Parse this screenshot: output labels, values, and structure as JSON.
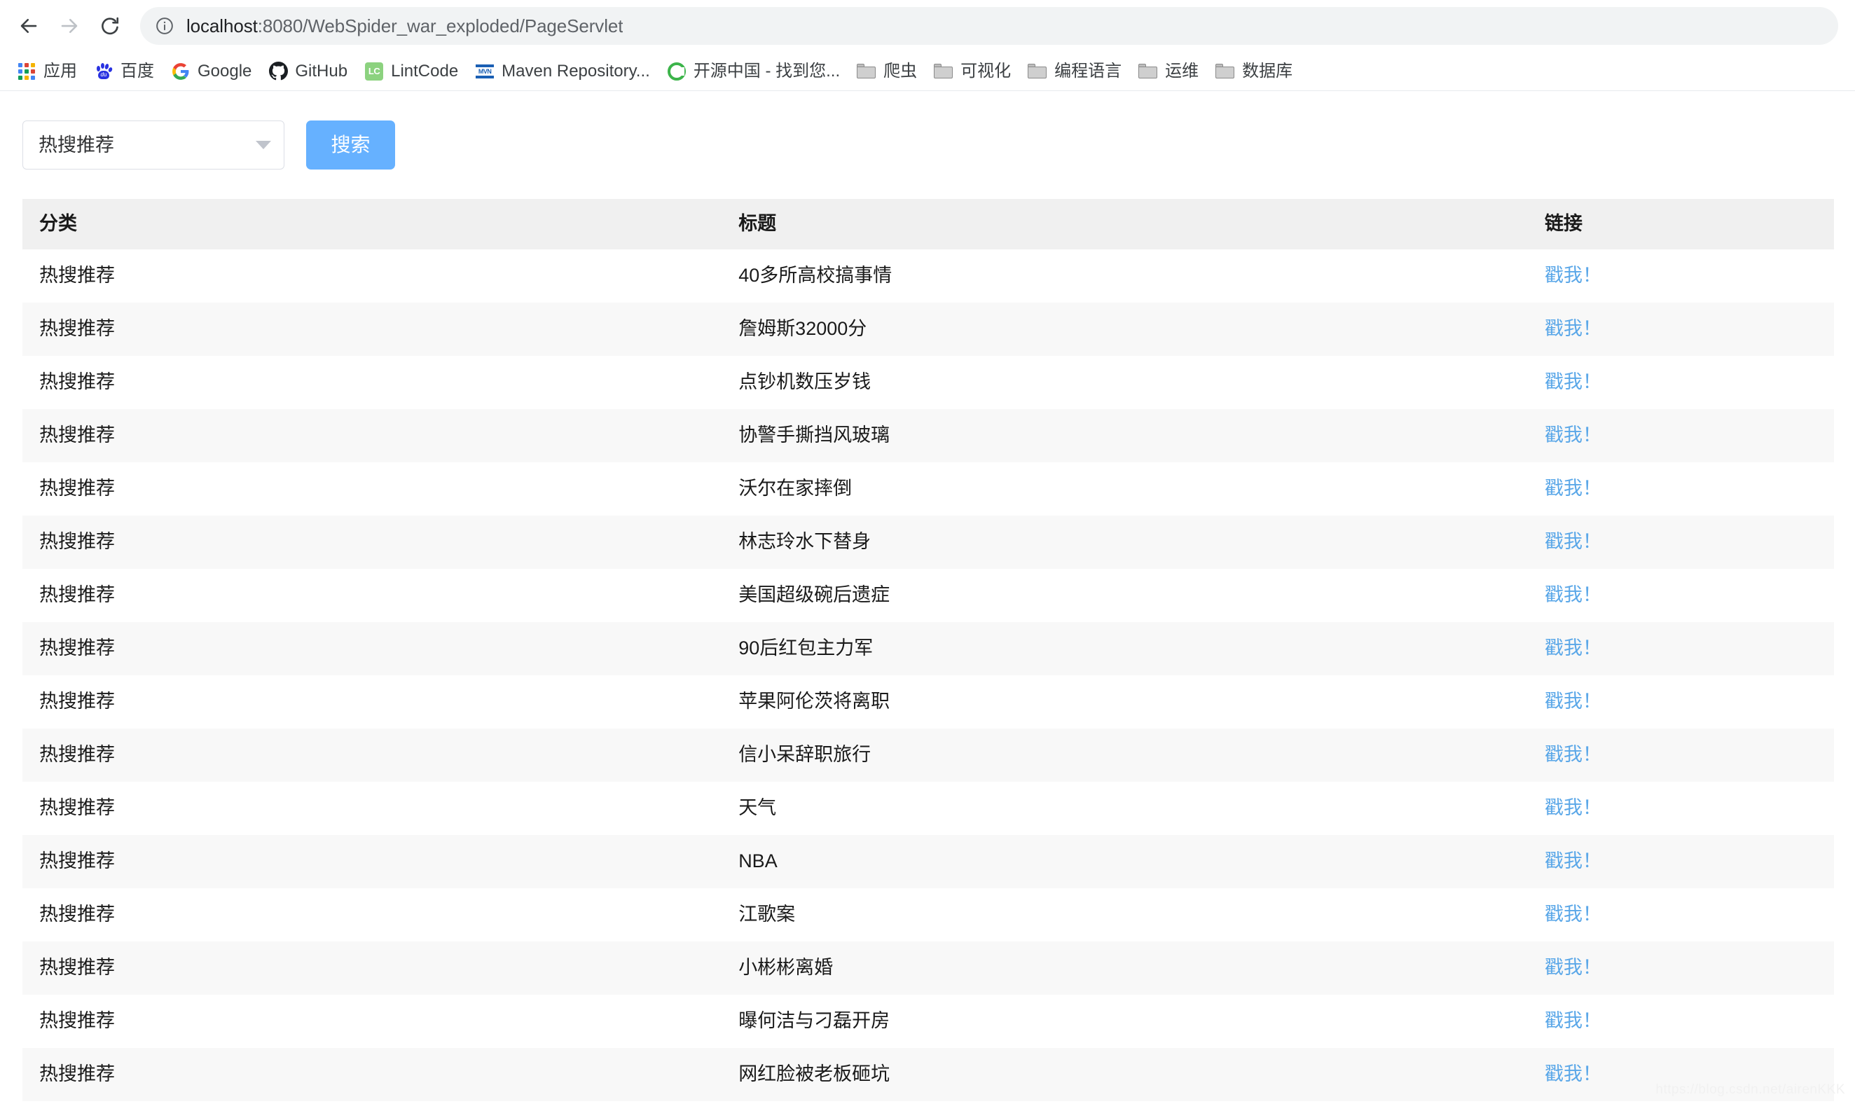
{
  "browser": {
    "back_icon": "back-arrow-icon",
    "forward_icon": "forward-arrow-icon",
    "reload_icon": "reload-icon",
    "info_icon": "info-circle-icon",
    "url_host": "localhost",
    "url_path": ":8080/WebSpider_war_exploded/PageServlet",
    "url_full": "localhost:8080/WebSpider_war_exploded/PageServlet",
    "bookmarks": [
      {
        "label": "应用",
        "icon": "apps-grid-icon"
      },
      {
        "label": "百度",
        "icon": "baidu-icon"
      },
      {
        "label": "Google",
        "icon": "google-icon"
      },
      {
        "label": "GitHub",
        "icon": "github-icon"
      },
      {
        "label": "LintCode",
        "icon": "lintcode-icon"
      },
      {
        "label": "Maven Repository...",
        "icon": "maven-icon"
      },
      {
        "label": "开源中国 - 找到您...",
        "icon": "oschina-icon"
      },
      {
        "label": "爬虫",
        "icon": "folder-icon"
      },
      {
        "label": "可视化",
        "icon": "folder-icon"
      },
      {
        "label": "编程语言",
        "icon": "folder-icon"
      },
      {
        "label": "运维",
        "icon": "folder-icon"
      },
      {
        "label": "数据库",
        "icon": "folder-icon"
      }
    ]
  },
  "controls": {
    "select_value": "热搜推荐",
    "select_caret_icon": "chevron-down-icon",
    "search_button_label": "搜索"
  },
  "table": {
    "headers": {
      "category": "分类",
      "title": "标题",
      "link": "链接"
    },
    "rows": [
      {
        "category": "热搜推荐",
        "title": "40多所高校搞事情",
        "link": "戳我！"
      },
      {
        "category": "热搜推荐",
        "title": "詹姆斯32000分",
        "link": "戳我！"
      },
      {
        "category": "热搜推荐",
        "title": "点钞机数压岁钱",
        "link": "戳我！"
      },
      {
        "category": "热搜推荐",
        "title": "协警手撕挡风玻璃",
        "link": "戳我！"
      },
      {
        "category": "热搜推荐",
        "title": "沃尔在家摔倒",
        "link": "戳我！"
      },
      {
        "category": "热搜推荐",
        "title": "林志玲水下替身",
        "link": "戳我！"
      },
      {
        "category": "热搜推荐",
        "title": "美国超级碗后遗症",
        "link": "戳我！"
      },
      {
        "category": "热搜推荐",
        "title": "90后红包主力军",
        "link": "戳我！"
      },
      {
        "category": "热搜推荐",
        "title": "苹果阿伦茨将离职",
        "link": "戳我！"
      },
      {
        "category": "热搜推荐",
        "title": "信小呆辞职旅行",
        "link": "戳我！"
      },
      {
        "category": "热搜推荐",
        "title": "天气",
        "link": "戳我！"
      },
      {
        "category": "热搜推荐",
        "title": "NBA",
        "link": "戳我！"
      },
      {
        "category": "热搜推荐",
        "title": "江歌案",
        "link": "戳我！"
      },
      {
        "category": "热搜推荐",
        "title": "小彬彬离婚",
        "link": "戳我！"
      },
      {
        "category": "热搜推荐",
        "title": "曝何洁与刁磊开房",
        "link": "戳我！"
      },
      {
        "category": "热搜推荐",
        "title": "网红脸被老板砸坑",
        "link": "戳我！"
      }
    ]
  },
  "watermark": "https://blog.csdn.net/airenKKK",
  "colors": {
    "accent_blue": "#66b1ff",
    "link_blue": "#5aa7e8",
    "header_grey": "#f0f0f0",
    "stripe_grey": "#f8f8f8",
    "omnibox_grey": "#f1f3f4"
  }
}
